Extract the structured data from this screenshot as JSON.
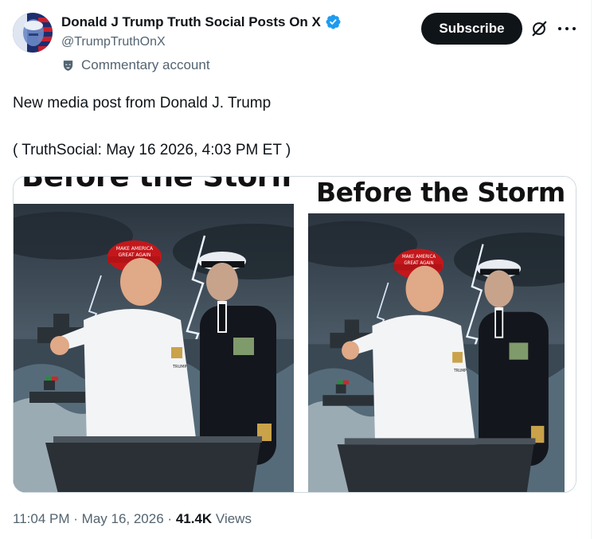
{
  "author": {
    "display_name": "Donald J Trump Truth Social Posts On X",
    "handle": "@TrumpTruthOnX",
    "account_label": "Commentary account"
  },
  "actions": {
    "subscribe_label": "Subscribe"
  },
  "post": {
    "text": "New media post from Donald J. Trump",
    "source_line": "( TruthSocial: May 16 2026, 4:03 PM ET )"
  },
  "media": {
    "poster_title": "Before the Storm",
    "cap_text": "MAKE AMERICA GREAT AGAIN",
    "shirt_text": "TRUMP"
  },
  "footer": {
    "time": "11:04 PM",
    "date": "May 16, 2026",
    "separator": "·",
    "views_count": "41.4K",
    "views_label": "Views"
  },
  "colors": {
    "verified": "#1d9bf0",
    "text_primary": "#0f1419",
    "text_secondary": "#536471",
    "button_bg": "#0f1419"
  },
  "icons": [
    "verified-badge-icon",
    "commentary-mask-icon",
    "grok-icon",
    "more-icon"
  ]
}
